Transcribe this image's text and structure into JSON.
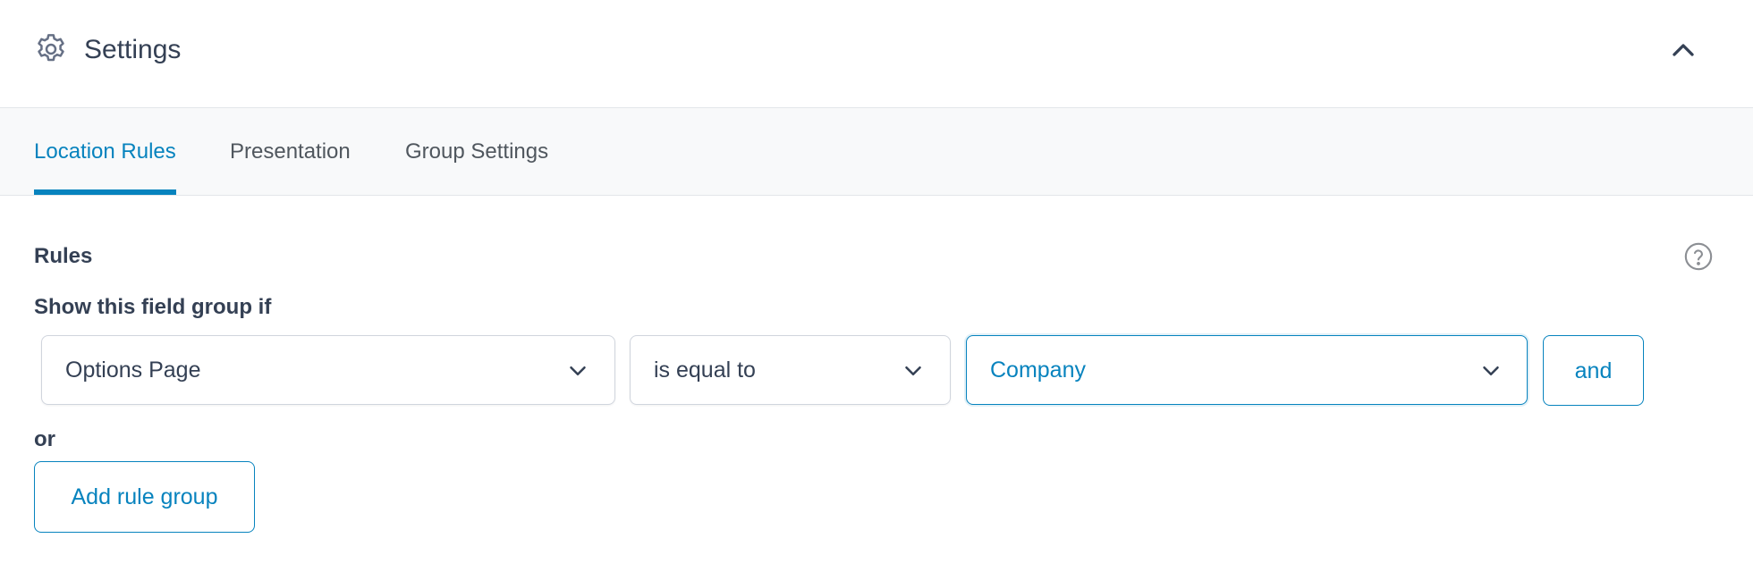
{
  "header": {
    "title": "Settings",
    "icon": "gear-icon",
    "collapse_icon": "chevron-up-icon"
  },
  "tabs": [
    {
      "label": "Location Rules",
      "active": true
    },
    {
      "label": "Presentation",
      "active": false
    },
    {
      "label": "Group Settings",
      "active": false
    }
  ],
  "rules": {
    "heading": "Rules",
    "help_icon": "question-circle-icon",
    "show_if_label": "Show this field group if",
    "param_value": "Options Page",
    "operator_value": "is equal to",
    "value_value": "Company",
    "and_label": "and",
    "or_label": "or",
    "add_group_label": "Add rule group"
  },
  "colors": {
    "accent": "#0783be",
    "text": "#344054",
    "muted": "#50575e",
    "border": "#d0d5dd",
    "tabs_bg": "#f8f9fa"
  }
}
